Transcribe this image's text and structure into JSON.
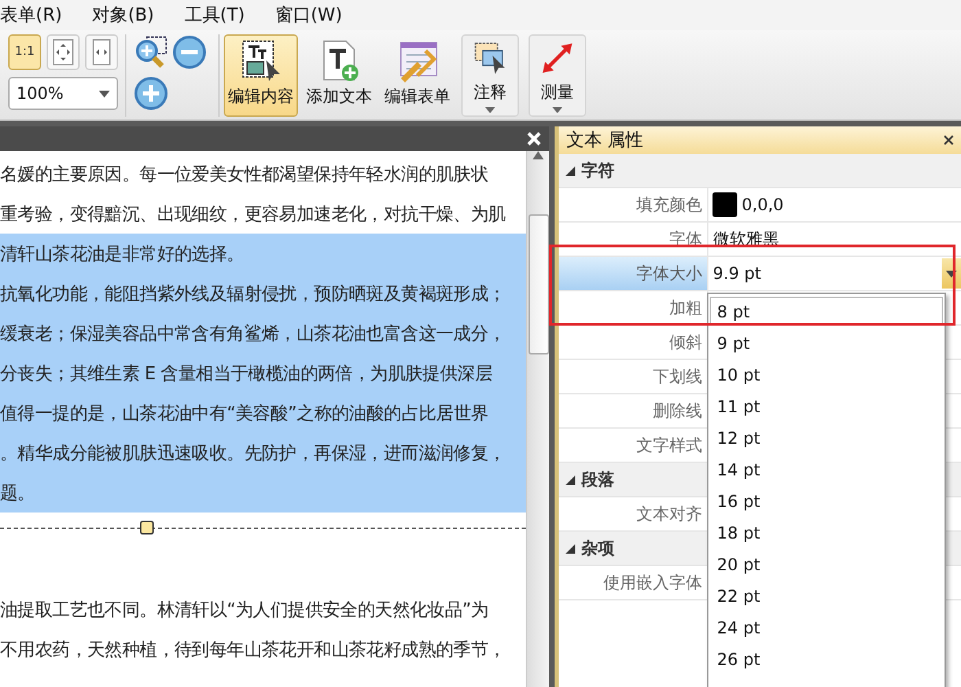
{
  "menu": [
    {
      "label": "表单(R)"
    },
    {
      "label": "对象(B)"
    },
    {
      "label": "工具(T)"
    },
    {
      "label": "窗口(W)"
    }
  ],
  "toolbar": {
    "view_buttons": [
      {
        "kind": "actual-size",
        "label": "1:1",
        "selected": true
      },
      {
        "kind": "fit-page",
        "selected": false
      },
      {
        "kind": "fit-width",
        "selected": false
      }
    ],
    "zoom": {
      "value": "100%"
    },
    "tools": [
      {
        "kind": "edit-content",
        "label": "编辑内容",
        "selected": true,
        "dropdown": false
      },
      {
        "kind": "add-text",
        "label": "添加文本",
        "selected": false,
        "dropdown": false
      },
      {
        "kind": "edit-form",
        "label": "编辑表单",
        "selected": false,
        "dropdown": false
      },
      {
        "kind": "comment",
        "label": "注释",
        "selected": false,
        "dropdown": true
      },
      {
        "kind": "measure",
        "label": "测量",
        "selected": false,
        "dropdown": true
      }
    ]
  },
  "document": {
    "blocks": [
      {
        "lines": [
          {
            "text": "名媛的主要原因。每一位爱美女性都渴望保持年轻水润的肌肤状",
            "selected": false
          },
          {
            "text": "重考验，变得黯沉、出现细纹，更容易加速老化，对抗干燥、为肌",
            "selected": false
          },
          {
            "text": "清轩山茶花油是非常好的选择。",
            "selected": true
          },
          {
            "text": "抗氧化功能，能阻挡紫外线及辐射侵扰，预防晒斑及黄褐斑形成；",
            "selected": true
          },
          {
            "text": "缓衰老；保湿美容品中常含有角鲨烯，山茶花油也富含这一成分，",
            "selected": true
          },
          {
            "text": "分丧失；其维生素 E 含量相当于橄榄油的两倍，为肌肤提供深层",
            "selected": true
          },
          {
            "text": "值得一提的是，山茶花油中有“美容酸”之称的油酸的占比居世界",
            "selected": true
          },
          {
            "text": "。精华成分能被肌肤迅速吸收。先防护，再保湿，进而滋润修复，",
            "selected": true
          },
          {
            "text": "题。",
            "selected": true
          }
        ]
      },
      {
        "lines": [
          {
            "text": "油提取工艺也不同。林清轩以“为人们提供安全的天然化妆品”为",
            "selected": false
          },
          {
            "text": "不用农药，天然种植，待到每年山茶花开和山茶花籽成熟的季节，",
            "selected": false
          }
        ]
      }
    ]
  },
  "properties": {
    "title": "文本 属性",
    "sections": [
      {
        "title": "字符",
        "expanded": true,
        "rows": [
          {
            "label": "填充颜色",
            "kind": "color",
            "color": "#000000",
            "value": "0,0,0",
            "selected": false
          },
          {
            "label": "字体",
            "kind": "text",
            "value": "微软雅黑",
            "selected": false
          },
          {
            "label": "字体大小",
            "kind": "dropdown",
            "value": "9.9 pt",
            "selected": true
          },
          {
            "label": "加粗",
            "kind": "text",
            "selected": false
          },
          {
            "label": "倾斜",
            "kind": "text",
            "selected": false
          },
          {
            "label": "下划线",
            "kind": "text",
            "selected": false
          },
          {
            "label": "删除线",
            "kind": "text",
            "selected": false
          },
          {
            "label": "文字样式",
            "kind": "text",
            "selected": false
          }
        ]
      },
      {
        "title": "段落",
        "expanded": true,
        "rows": [
          {
            "label": "文本对齐",
            "kind": "text",
            "selected": false
          }
        ]
      },
      {
        "title": "杂项",
        "expanded": true,
        "rows": [
          {
            "label": "使用嵌入字体",
            "kind": "text",
            "selected": false
          }
        ]
      }
    ],
    "dropdown_options": [
      {
        "label": "8 pt",
        "selected": true
      },
      {
        "label": "9 pt",
        "selected": false
      },
      {
        "label": "10 pt",
        "selected": false
      },
      {
        "label": "11 pt",
        "selected": false
      },
      {
        "label": "12 pt",
        "selected": false
      },
      {
        "label": "14 pt",
        "selected": false
      },
      {
        "label": "16 pt",
        "selected": false
      },
      {
        "label": "18 pt",
        "selected": false
      },
      {
        "label": "20 pt",
        "selected": false
      },
      {
        "label": "22 pt",
        "selected": false
      },
      {
        "label": "24 pt",
        "selected": false
      },
      {
        "label": "26 pt",
        "selected": false
      }
    ]
  }
}
